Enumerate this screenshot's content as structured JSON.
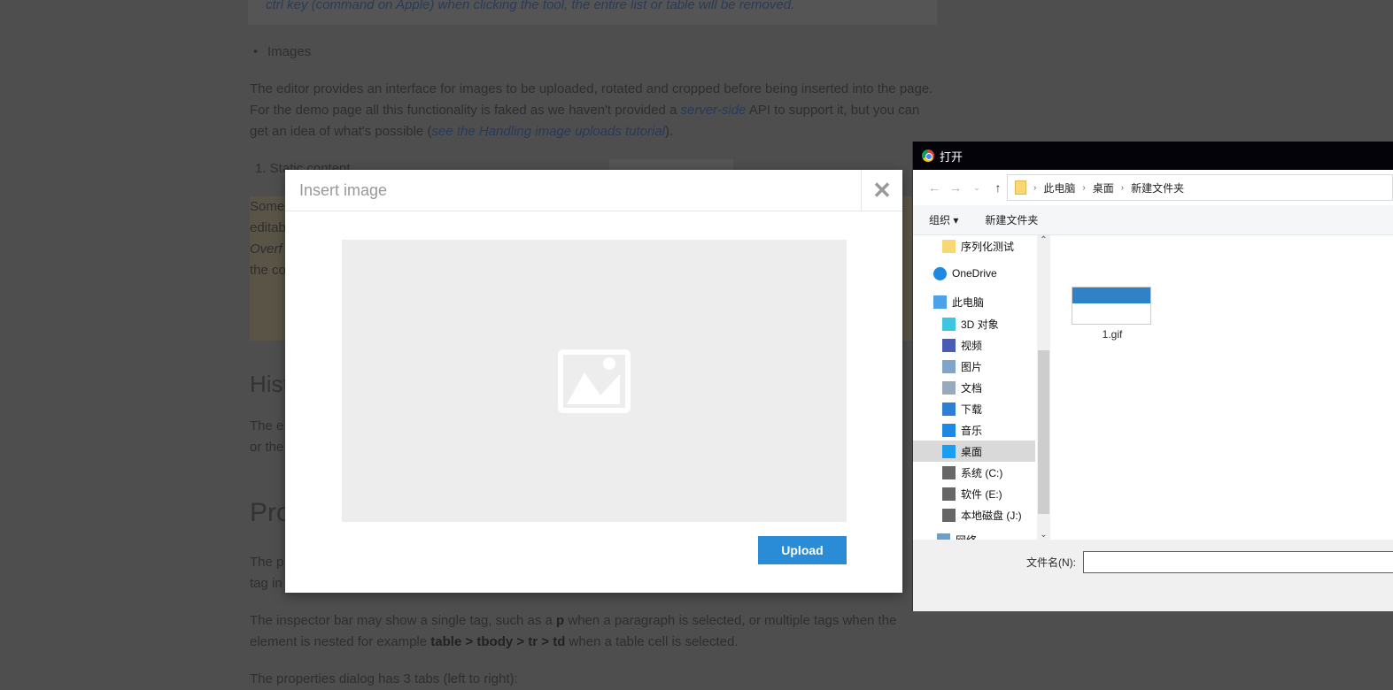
{
  "background_page": {
    "note_text": "ctrl key (command on Apple) when clicking the tool, the entire list or table will be removed.",
    "bullet_images": "Images",
    "images_paragraph": {
      "part1": "The editor provides an interface for images to be uploaded, rotated and cropped before being inserted into the page. For the demo page all this functionality is faked as we haven't provided a ",
      "em1": "server-side",
      "part2": " API to support it, but you can get an idea of what's possible (",
      "em2": "see the Handling image uploads tutorial",
      "part3": ")."
    },
    "ol_item": "1. Static content",
    "warm_lines": [
      "Some",
      "editab",
      "Overf",
      "the co"
    ],
    "heading_history": "Hist",
    "history_lines": [
      "The e",
      "or the"
    ],
    "heading_properties": "Pro",
    "properties_lines": [
      "The p",
      "tag in"
    ],
    "inspector_paragraph": {
      "part1": "The inspector bar may show a single tag, such as a ",
      "b1": "p",
      "part2": " when a paragraph is selected, or multiple tags when the element is nested for example ",
      "b2": "table > tbody > tr > td",
      "part3": " when a table cell is selected."
    },
    "tabs_line": "The properties dialog has 3 tabs (left to right):"
  },
  "insert_image_modal": {
    "title": "Insert image",
    "close_label": "✕",
    "upload_label": "Upload",
    "accent_color": "#2a8bd6"
  },
  "file_dialog": {
    "title": "打开",
    "breadcrumb": [
      "此电脑",
      "桌面",
      "新建文件夹"
    ],
    "toolbar": {
      "organize": "组织 ▾",
      "new_folder": "新建文件夹"
    },
    "nav_items": [
      {
        "label": "序列化测试",
        "icon": "folder-icon"
      },
      {
        "label": "OneDrive",
        "icon": "cloud-icon"
      },
      {
        "label": "此电脑",
        "icon": "computer-icon"
      },
      {
        "label": "3D 对象",
        "icon": "cube-icon"
      },
      {
        "label": "视频",
        "icon": "video-icon"
      },
      {
        "label": "图片",
        "icon": "picture-icon"
      },
      {
        "label": "文档",
        "icon": "document-icon"
      },
      {
        "label": "下载",
        "icon": "download-icon"
      },
      {
        "label": "音乐",
        "icon": "music-icon"
      },
      {
        "label": "桌面",
        "icon": "desktop-icon",
        "selected": true
      },
      {
        "label": "系统 (C:)",
        "icon": "drive-icon"
      },
      {
        "label": "软件 (E:)",
        "icon": "drive-icon"
      },
      {
        "label": "本地磁盘 (J:)",
        "icon": "drive-icon"
      },
      {
        "label": "网络",
        "icon": "network-icon"
      }
    ],
    "files": [
      {
        "name": "1.gif"
      }
    ],
    "filename_label": "文件名(N):",
    "filename_value": ""
  }
}
